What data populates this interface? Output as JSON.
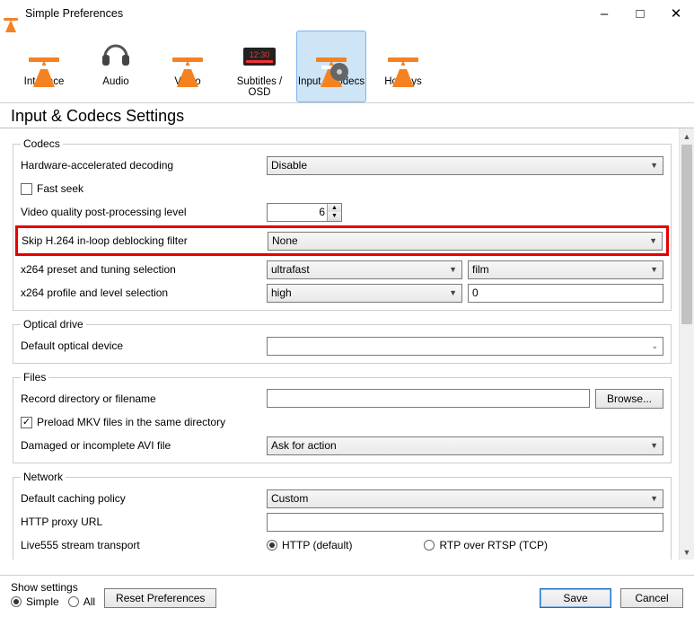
{
  "window": {
    "title": "Simple Preferences"
  },
  "tabs": {
    "interface": "Interface",
    "audio": "Audio",
    "video": "Video",
    "subtitles": "Subtitles / OSD",
    "input": "Input / Codecs",
    "hotkeys": "Hotkeys"
  },
  "heading": "Input & Codecs Settings",
  "groups": {
    "codecs": {
      "legend": "Codecs",
      "hw_label": "Hardware-accelerated decoding",
      "hw_value": "Disable",
      "fastseek_label": "Fast seek",
      "fastseek_checked": false,
      "postproc_label": "Video quality post-processing level",
      "postproc_value": "6",
      "skip_label": "Skip H.264 in-loop deblocking filter",
      "skip_value": "None",
      "x264preset_label": "x264 preset and tuning selection",
      "x264preset_value": "ultrafast",
      "x264tune_value": "film",
      "x264profile_label": "x264 profile and level selection",
      "x264profile_value": "high",
      "x264level_value": "0"
    },
    "optical": {
      "legend": "Optical drive",
      "default_label": "Default optical device",
      "default_value": ""
    },
    "files": {
      "legend": "Files",
      "record_label": "Record directory or filename",
      "record_value": "",
      "browse": "Browse...",
      "preload_label": "Preload MKV files in the same directory",
      "preload_checked": true,
      "damaged_label": "Damaged or incomplete AVI file",
      "damaged_value": "Ask for action"
    },
    "network": {
      "legend": "Network",
      "cache_label": "Default caching policy",
      "cache_value": "Custom",
      "proxy_label": "HTTP proxy URL",
      "proxy_value": "",
      "live555_label": "Live555 stream transport",
      "live555_http": "HTTP (default)",
      "live555_rtp": "RTP over RTSP (TCP)",
      "live555_selected": "http"
    }
  },
  "footer": {
    "show_settings": "Show settings",
    "simple": "Simple",
    "all": "All",
    "reset": "Reset Preferences",
    "save": "Save",
    "cancel": "Cancel"
  }
}
